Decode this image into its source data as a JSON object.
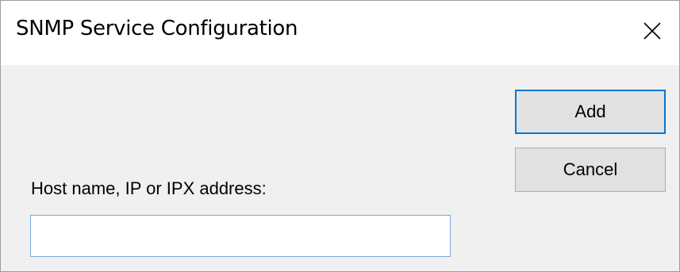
{
  "dialog": {
    "title": "SNMP Service Configuration",
    "close_icon": "close-icon"
  },
  "buttons": {
    "add_label": "Add",
    "cancel_label": "Cancel"
  },
  "host_field": {
    "label": "Host name, IP or IPX address:",
    "value": "",
    "placeholder": ""
  },
  "colors": {
    "accent": "#0078d7",
    "dialog_bg": "#f0f0f0",
    "titlebar_bg": "#ffffff",
    "button_bg": "#e1e1e1"
  }
}
